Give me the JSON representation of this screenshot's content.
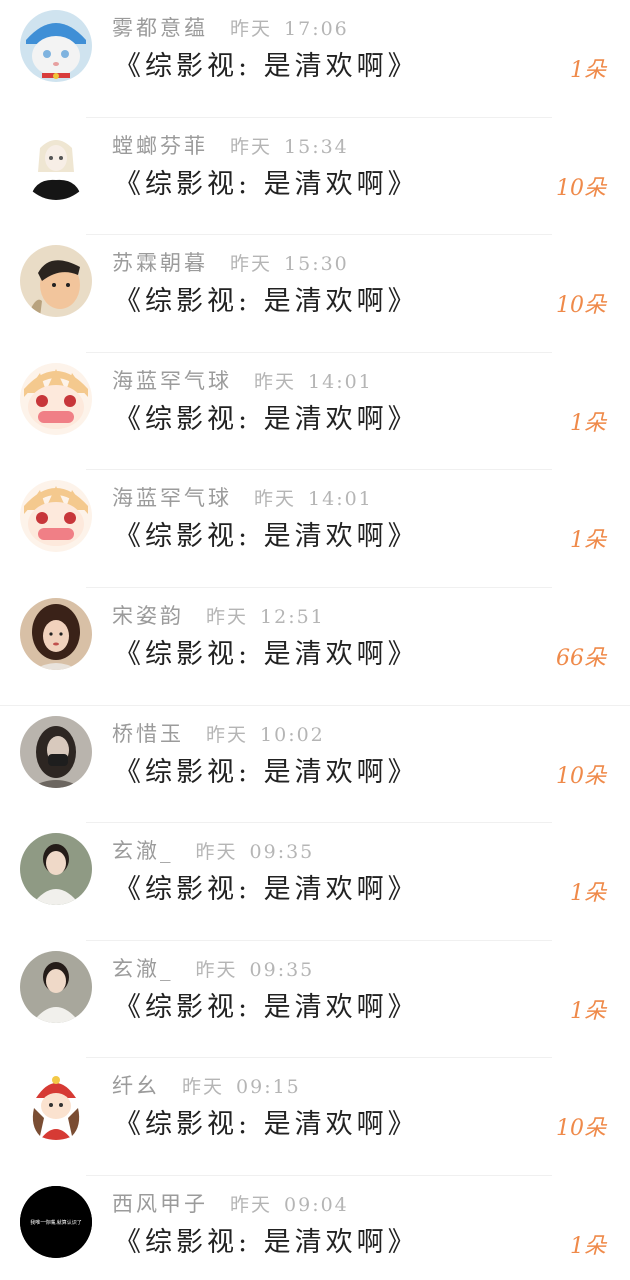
{
  "rows": [
    {
      "name": "雾都意蕴",
      "date": "昨天",
      "time": "17:06",
      "work": "《综影视:  是清欢啊》",
      "count": "1朵",
      "avatar": "cat-avatar"
    },
    {
      "name": "螳螂芬菲",
      "date": "昨天",
      "time": "15:34",
      "work": "《综影视:  是清欢啊》",
      "count": "10朵",
      "avatar": "anime-girl-avatar"
    },
    {
      "name": "苏霖朝暮",
      "date": "昨天",
      "time": "15:30",
      "work": "《综影视:  是清欢啊》",
      "count": "10朵",
      "avatar": "cartoon-boy-avatar"
    },
    {
      "name": "海蓝罕气球",
      "date": "昨天",
      "time": "14:01",
      "work": "《综影视:  是清欢啊》",
      "count": "1朵",
      "avatar": "crying-anime-avatar"
    },
    {
      "name": "海蓝罕气球",
      "date": "昨天",
      "time": "14:01",
      "work": "《综影视:  是清欢啊》",
      "count": "1朵",
      "avatar": "crying-anime-avatar"
    },
    {
      "name": "宋姿韵",
      "date": "昨天",
      "time": "12:51",
      "work": "《综影视:  是清欢啊》",
      "count": "66朵",
      "avatar": "woman-photo-avatar"
    },
    {
      "name": "桥惜玉",
      "date": "昨天",
      "time": "10:02",
      "work": "《综影视:  是清欢啊》",
      "count": "10朵",
      "avatar": "masked-person-avatar"
    },
    {
      "name": "玄澈_",
      "date": "昨天",
      "time": "09:35",
      "work": "《综影视:  是清欢啊》",
      "count": "1朵",
      "avatar": "man-photo-avatar"
    },
    {
      "name": "玄澈_",
      "date": "昨天",
      "time": "09:35",
      "work": "《综影视:  是清欢啊》",
      "count": "1朵",
      "avatar": "man-photo-avatar"
    },
    {
      "name": "纤幺",
      "date": "昨天",
      "time": "09:15",
      "work": "《综影视:  是清欢啊》",
      "count": "10朵",
      "avatar": "cartoon-girl-avatar"
    },
    {
      "name": "西风甲子",
      "date": "昨天",
      "time": "09:04",
      "work": "《综影视:  是清欢啊》",
      "count": "1朵",
      "avatar": "black-text-avatar",
      "avatar_text": "我唯一你嘴,就算认识了"
    }
  ],
  "colors": {
    "name": "#9b9b9b",
    "time": "#b5b5b5",
    "work": "#222222",
    "count": "#ef8a4a",
    "separator": "#f0f0f0"
  }
}
